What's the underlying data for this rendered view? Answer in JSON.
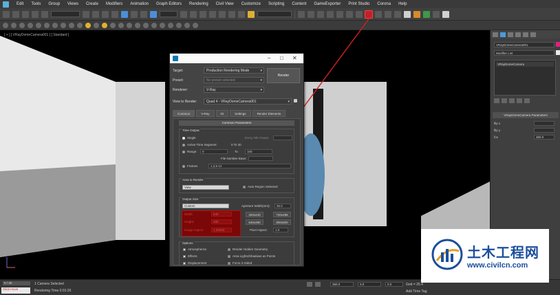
{
  "menu": [
    "Edit",
    "Tools",
    "Group",
    "Views",
    "Create",
    "Modifiers",
    "Animation",
    "Graph Editors",
    "Rendering",
    "Civil View",
    "Customize",
    "Scripting",
    "Content",
    "GameExporter",
    "Print Studio",
    "Corona",
    "Help"
  ],
  "toolbar": {
    "selection_filter": "All",
    "view_dropdown": "View",
    "named_selection": "Create Selection Set",
    "render_setup_icon": "render-setup-icon"
  },
  "viewport": {
    "label": "[ + ] [ VRayDomeCamera001 ] [ Standard ]"
  },
  "command_panel": {
    "object_name": "VRayDomeCamera001",
    "modifier_list": "Modifier List",
    "stack_item": "VRayDomeCamera",
    "rollout_title": "VRayDomeCamera Parameters",
    "params": [
      {
        "label": "flip x",
        "value": ""
      },
      {
        "label": "flip y",
        "value": ""
      },
      {
        "label": "fov",
        "value": "360.0"
      }
    ]
  },
  "dialog": {
    "target_label": "Target:",
    "target_value": "Production Rendering Mode",
    "preset_label": "Preset:",
    "preset_value": "No preset selected",
    "renderer_label": "Renderer:",
    "renderer_value": "V-Ray",
    "view_label": "View to Render:",
    "view_value": "Quad 4 - VRayDomeCamera001",
    "render_button": "Render",
    "tabs": [
      "Common",
      "V-Ray",
      "GI",
      "Settings",
      "Render Elements"
    ],
    "common_params_title": "Common Parameters",
    "time_output": {
      "title": "Time Output",
      "single": "Single",
      "every_nth": "Every Nth Frame:",
      "active_segment": "Active Time Segment:",
      "active_range": "0 To 30",
      "range": "Range:",
      "range_from": "0",
      "to": "To",
      "range_to": "100",
      "file_number_base": "File Number Base:",
      "frames": "Frames",
      "frames_value": "1,3,5-12"
    },
    "area_to_render": {
      "title": "Area to Render",
      "value": "View",
      "auto_region": "Auto Region Selected"
    },
    "output_size": {
      "title": "Output Size",
      "preset": "Custom",
      "aperture_label": "Aperture Width(mm):",
      "aperture_value": "36.0",
      "width_label": "Width:",
      "width_value": "640",
      "height_label": "Height:",
      "height_value": "480",
      "image_aspect_label": "Image Aspect:",
      "image_aspect_value": "1.33333",
      "presets": [
        "320x240",
        "720x486",
        "640x480",
        "800x600"
      ],
      "pixel_aspect_label": "Pixel Aspect:",
      "pixel_aspect_value": "1.0"
    },
    "options": {
      "title": "Options",
      "items": [
        "Atmospherics",
        "Render Hidden Geometry",
        "Effects",
        "Area Lights/Shadows as Points",
        "Displacement",
        "Force 2-Sided"
      ]
    }
  },
  "status": {
    "frame": "0 / 30",
    "selected": "1 Camera Selected",
    "rendering_time": "Rendering Time  0:01:26",
    "listener": "Click-move",
    "x": "360.0",
    "y": "0.0",
    "z": "0.0",
    "grid": "Grid = 25.4",
    "add_time_tag": "Add Time Tag"
  },
  "watermark": {
    "title": "土木工程网",
    "url": "www.civilcn.com"
  },
  "colors": {
    "accent": "#4a8fd8",
    "highlight_red": "#c0202a",
    "watermark_blue": "#1b4f9c"
  }
}
